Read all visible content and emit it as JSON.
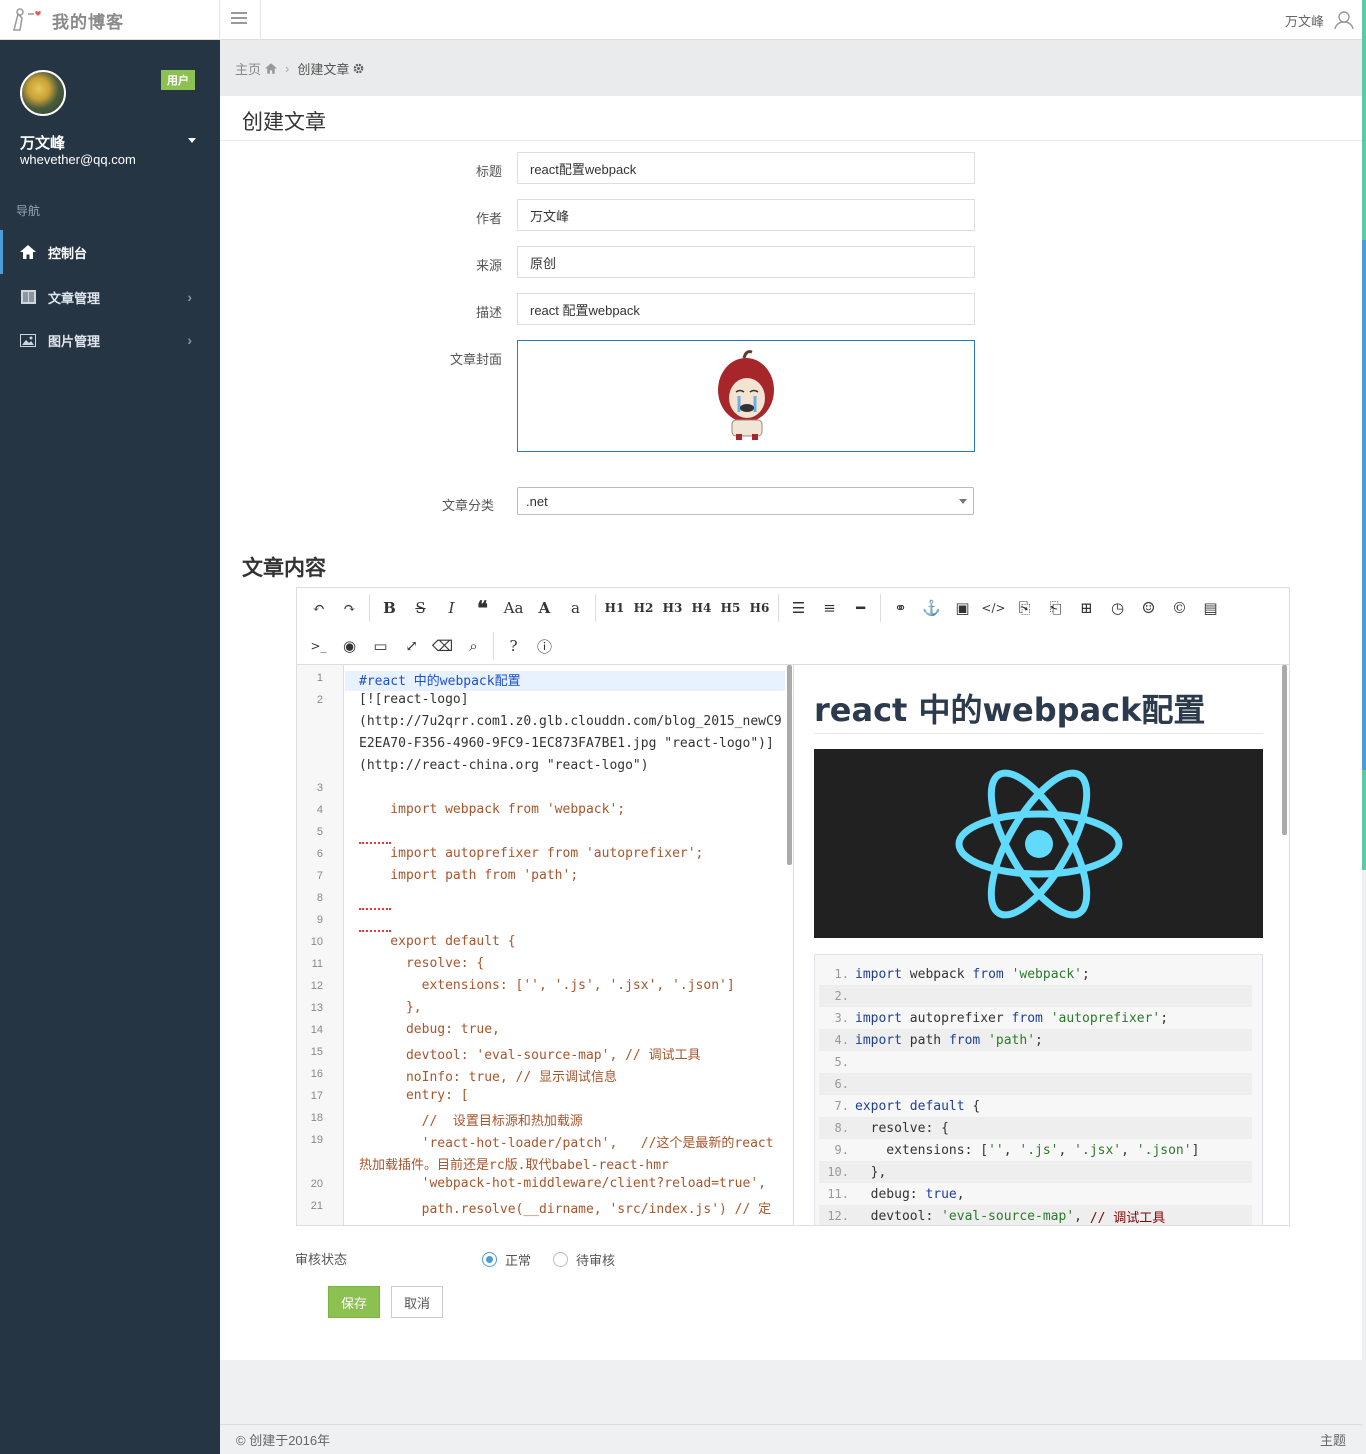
{
  "app": {
    "brand": "我的博客",
    "top_user": "万文峰"
  },
  "sidebar": {
    "role_badge": "用户",
    "user_name": "万文峰",
    "user_email": "whevether@qq.com",
    "nav_label": "导航",
    "items": [
      {
        "label": "控制台",
        "icon": "home-icon",
        "active": true
      },
      {
        "label": "文章管理",
        "icon": "columns-icon"
      },
      {
        "label": "图片管理",
        "icon": "image-icon"
      }
    ]
  },
  "breadcrumb": {
    "home": "主页",
    "current": "创建文章"
  },
  "page_title": "创建文章",
  "form": {
    "title_label": "标题",
    "title_value": "react配置webpack",
    "author_label": "作者",
    "author_value": "万文峰",
    "source_label": "来源",
    "source_value": "原创",
    "desc_label": "描述",
    "desc_value": "react 配置webpack",
    "cover_label": "文章封面",
    "category_label": "文章分类",
    "category_value": ".net"
  },
  "content_title": "文章内容",
  "toolbar": {
    "headings": [
      "H1",
      "H2",
      "H3",
      "H4",
      "H5",
      "H6"
    ],
    "aa_label": "Aa",
    "a_upper": "A",
    "a_lower": "a",
    "terminal": ">_"
  },
  "code_lines": [
    {
      "n": "1",
      "text": "#react 中的webpack配置",
      "cls": "blue"
    },
    {
      "n": "2",
      "text": "[![react-logo]",
      "cls": "dark"
    },
    {
      "n": "",
      "text": "(http://7u2qrr.com1.z0.glb.clouddn.com/blog_2015_newC9",
      "cls": "dark"
    },
    {
      "n": "",
      "text": "E2EA70-F356-4960-9FC9-1EC873FA7BE1.jpg \"react-logo\")]",
      "cls": "dark"
    },
    {
      "n": "",
      "text": "(http://react-china.org \"react-logo\")",
      "cls": "dark"
    },
    {
      "n": "3",
      "text": "",
      "cls": ""
    },
    {
      "n": "4",
      "text": "    import webpack from 'webpack';",
      "cls": ""
    },
    {
      "n": "5",
      "text": "",
      "cls": ""
    },
    {
      "n": "6",
      "text": "    import autoprefixer from 'autoprefixer';",
      "cls": ""
    },
    {
      "n": "7",
      "text": "    import path from 'path';",
      "cls": ""
    },
    {
      "n": "8",
      "text": "",
      "cls": ""
    },
    {
      "n": "9",
      "text": "",
      "cls": ""
    },
    {
      "n": "10",
      "text": "    export default {",
      "cls": ""
    },
    {
      "n": "11",
      "text": "      resolve: {",
      "cls": ""
    },
    {
      "n": "12",
      "text": "        extensions: ['', '.js', '.jsx', '.json']",
      "cls": ""
    },
    {
      "n": "13",
      "text": "      },",
      "cls": ""
    },
    {
      "n": "14",
      "text": "      debug: true,",
      "cls": ""
    },
    {
      "n": "15",
      "text": "      devtool: 'eval-source-map', // 调试工具",
      "cls": ""
    },
    {
      "n": "16",
      "text": "      noInfo: true, // 显示调试信息",
      "cls": ""
    },
    {
      "n": "17",
      "text": "      entry: [",
      "cls": ""
    },
    {
      "n": "18",
      "text": "        //  设置目标源和热加载源",
      "cls": ""
    },
    {
      "n": "19",
      "text": "        'react-hot-loader/patch',   //这个是最新的react",
      "cls": ""
    },
    {
      "n": "",
      "text": "热加载插件。目前还是rc版.取代babel-react-hmr",
      "cls": ""
    },
    {
      "n": "20",
      "text": "        'webpack-hot-middleware/client?reload=true',",
      "cls": ""
    },
    {
      "n": "21",
      "text": "        path.resolve(__dirname, 'src/index.js') // 定",
      "cls": ""
    }
  ],
  "preview": {
    "title": "react 中的webpack配置",
    "code": [
      {
        "n": "1.",
        "parts": [
          [
            "kw",
            "import"
          ],
          [
            "prop",
            " webpack "
          ],
          [
            "kw",
            "from"
          ],
          [
            "prop",
            " "
          ],
          [
            "str",
            "'webpack'"
          ],
          [
            "prop",
            ";"
          ]
        ]
      },
      {
        "n": "2.",
        "parts": []
      },
      {
        "n": "3.",
        "parts": [
          [
            "kw",
            "import"
          ],
          [
            "prop",
            " autoprefixer "
          ],
          [
            "kw",
            "from"
          ],
          [
            "prop",
            " "
          ],
          [
            "str",
            "'autoprefixer'"
          ],
          [
            "prop",
            ";"
          ]
        ]
      },
      {
        "n": "4.",
        "parts": [
          [
            "kw",
            "import"
          ],
          [
            "prop",
            " path "
          ],
          [
            "kw",
            "from"
          ],
          [
            "prop",
            " "
          ],
          [
            "str",
            "'path'"
          ],
          [
            "prop",
            ";"
          ]
        ]
      },
      {
        "n": "5.",
        "parts": []
      },
      {
        "n": "6.",
        "parts": []
      },
      {
        "n": "7.",
        "parts": [
          [
            "kw",
            "export"
          ],
          [
            "prop",
            " "
          ],
          [
            "kw",
            "default"
          ],
          [
            "prop",
            " {"
          ]
        ]
      },
      {
        "n": "8.",
        "parts": [
          [
            "prop",
            "  resolve: {"
          ]
        ]
      },
      {
        "n": "9.",
        "parts": [
          [
            "prop",
            "    extensions: ["
          ],
          [
            "str",
            "''"
          ],
          [
            "prop",
            ", "
          ],
          [
            "str",
            "'.js'"
          ],
          [
            "prop",
            ", "
          ],
          [
            "str",
            "'.jsx'"
          ],
          [
            "prop",
            ", "
          ],
          [
            "str",
            "'.json'"
          ],
          [
            "prop",
            "]"
          ]
        ]
      },
      {
        "n": "10.",
        "parts": [
          [
            "prop",
            "  },"
          ]
        ]
      },
      {
        "n": "11.",
        "parts": [
          [
            "prop",
            "  debug: "
          ],
          [
            "kw",
            "true"
          ],
          [
            "prop",
            ","
          ]
        ]
      },
      {
        "n": "12.",
        "parts": [
          [
            "prop",
            "  devtool: "
          ],
          [
            "str",
            "'eval-source-map'"
          ],
          [
            "prop",
            ", "
          ],
          [
            "cmt",
            "// 调试工具"
          ]
        ]
      }
    ]
  },
  "status": {
    "label": "审核状态",
    "option_normal": "正常",
    "option_pending": "待审核",
    "selected": "正常"
  },
  "buttons": {
    "save": "保存",
    "cancel": "取消"
  },
  "footer": {
    "copyright": "© 创建于2016年",
    "theme": "主题"
  },
  "colors": {
    "sidebar_bg": "#253544",
    "accent_green": "#8cc152",
    "accent_blue": "#4a9ed8"
  }
}
